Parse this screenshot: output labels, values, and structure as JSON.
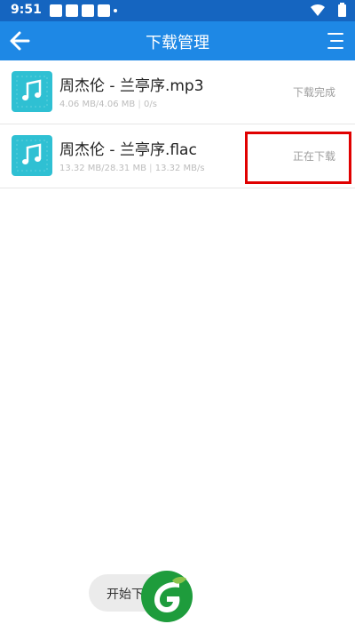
{
  "status_bar": {
    "time": "9:51"
  },
  "toolbar": {
    "title": "下载管理",
    "back_icon": "arrow-left-icon",
    "menu_icon": "menu-lines-icon"
  },
  "downloads": [
    {
      "name": "周杰伦 - 兰亭序.mp3",
      "size_done": "4.06 MB/4.06 MB",
      "speed": "0/s",
      "status": "下载完成"
    },
    {
      "name": "周杰伦 - 兰亭序.flac",
      "size_done": "13.32 MB/28.31 MB",
      "speed": "13.32 MB/s",
      "status": "正在下载"
    }
  ],
  "toast": {
    "text": "开始下"
  },
  "colors": {
    "status_bar": "#1565c0",
    "toolbar": "#1e88e5",
    "icon_bg": "#2fc0d3",
    "highlight": "#e00000"
  }
}
